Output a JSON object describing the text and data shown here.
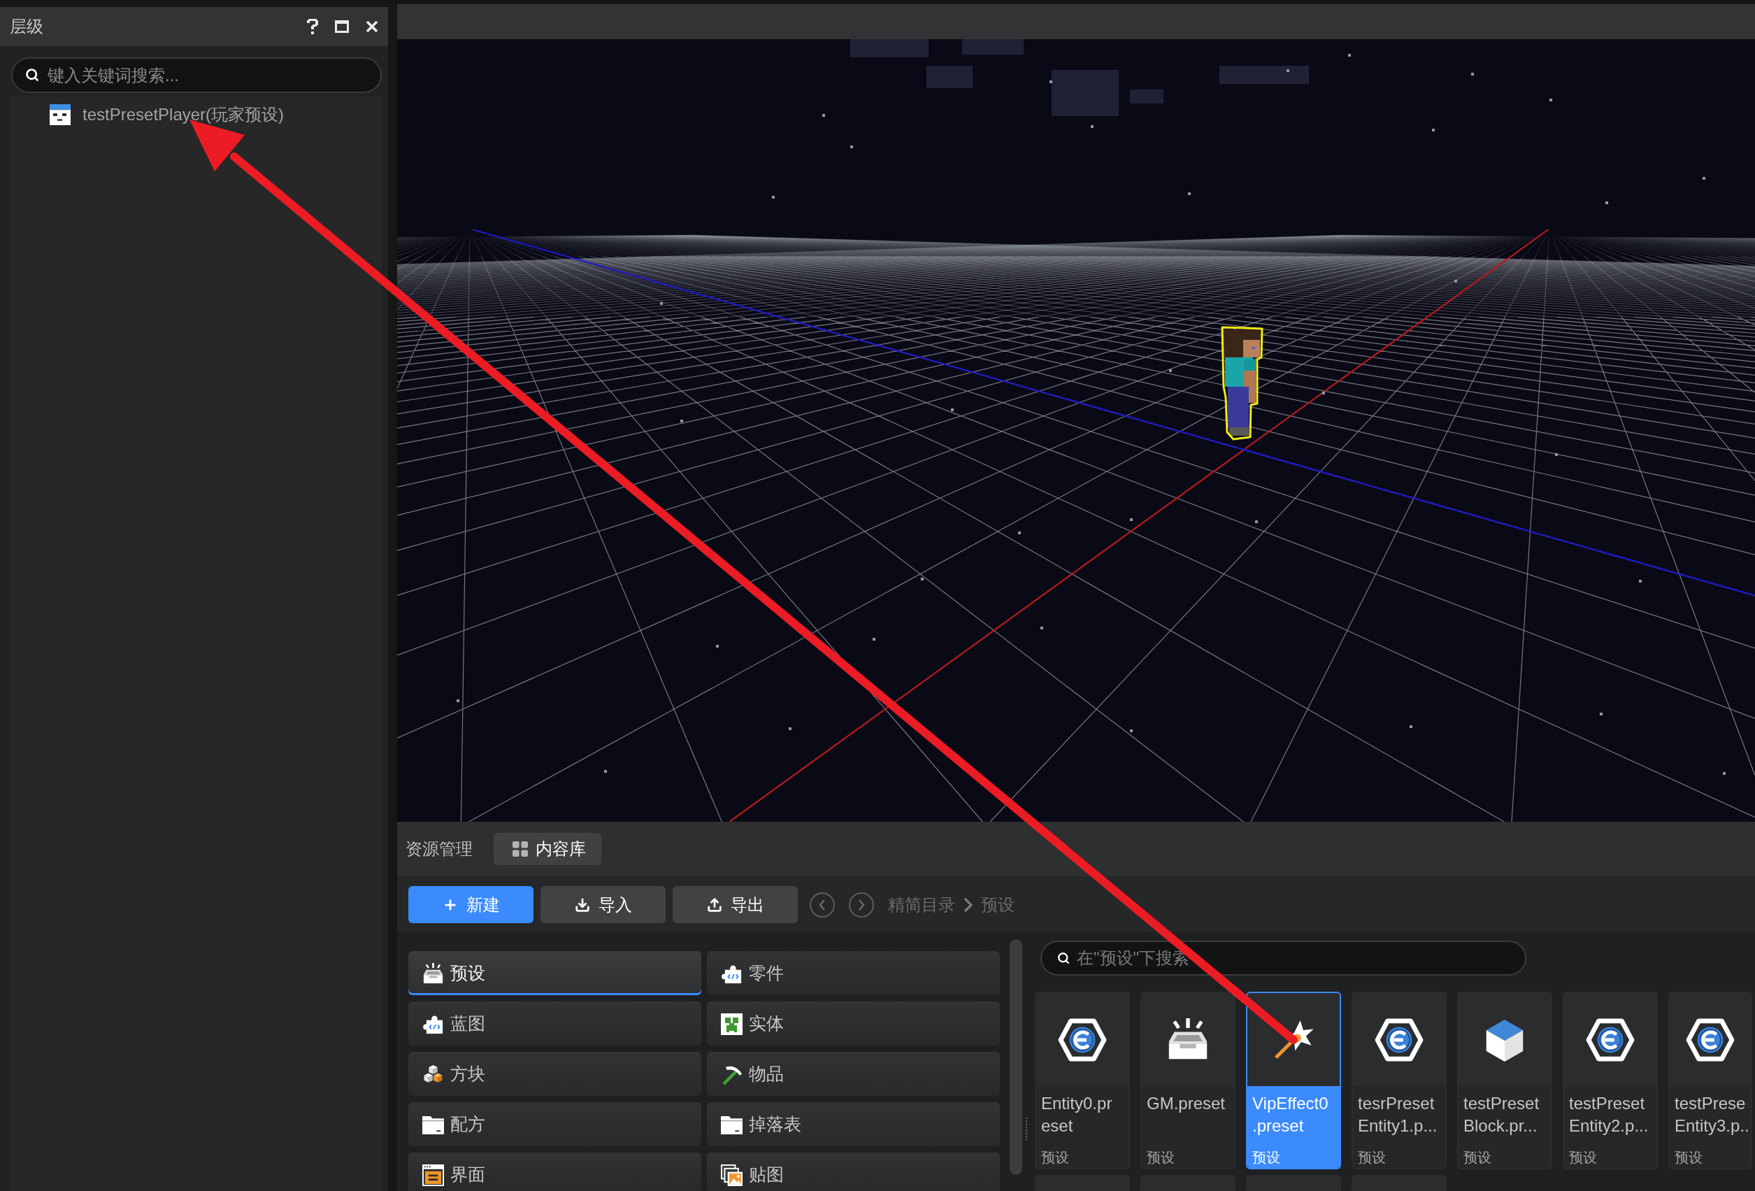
{
  "hierarchy_panel": {
    "title": "层级",
    "search": {
      "placeholder": "键入关键词搜索..."
    },
    "tree": [
      {
        "label": "testPresetPlayer(玩家预设)",
        "kind": "player",
        "selected": false
      }
    ]
  },
  "asset_panel": {
    "title": "资源管理",
    "tabs": [
      {
        "label": "内容库",
        "selected": true
      }
    ],
    "toolbar": [
      {
        "label": "新建",
        "kind": "new"
      },
      {
        "label": "导入",
        "kind": "import"
      },
      {
        "label": "导出",
        "kind": "export"
      }
    ],
    "breadcrumb": [
      "精简目录",
      "预设"
    ],
    "categories": [
      {
        "label": "预设",
        "kind": "preset",
        "selected": true
      },
      {
        "label": "零件",
        "kind": "part",
        "selected": false
      },
      {
        "label": "蓝图",
        "kind": "blueprint",
        "selected": false
      },
      {
        "label": "实体",
        "kind": "entity",
        "selected": false
      },
      {
        "label": "方块",
        "kind": "block",
        "selected": false
      },
      {
        "label": "物品",
        "kind": "item",
        "selected": false
      },
      {
        "label": "配方",
        "kind": "recipe",
        "selected": false
      },
      {
        "label": "掉落表",
        "kind": "loot_table",
        "selected": false
      },
      {
        "label": "界面",
        "kind": "ui",
        "selected": false
      },
      {
        "label": "贴图",
        "kind": "texture",
        "selected": false
      }
    ],
    "search": {
      "placeholder": "在\"预设\"下搜索"
    },
    "assets": [
      {
        "kind": "entity",
        "name_lines": [
          "Entity0.pr",
          "eset"
        ],
        "type": "预设",
        "selected": false
      },
      {
        "kind": "preset",
        "name_lines": [
          "GM.preset"
        ],
        "type": "预设",
        "selected": false
      },
      {
        "kind": "effect",
        "name_lines": [
          "VipEffect0",
          ".preset"
        ],
        "type": "预设",
        "selected": true
      },
      {
        "kind": "entity",
        "name_lines": [
          "tesrPreset",
          "Entity1.p..."
        ],
        "type": "预设",
        "selected": false
      },
      {
        "kind": "block",
        "name_lines": [
          "testPreset",
          "Block.pr..."
        ],
        "type": "预设",
        "selected": false
      },
      {
        "kind": "entity",
        "name_lines": [
          "testPreset",
          "Entity2.p..."
        ],
        "type": "预设",
        "selected": false
      },
      {
        "kind": "entity",
        "name_lines": [
          "testPrese",
          "Entity3.p.."
        ],
        "type": "预设",
        "selected": false
      },
      {
        "kind": "clipped"
      },
      {
        "kind": "clipped"
      },
      {
        "kind": "clipped"
      },
      {
        "kind": "clipped"
      }
    ]
  }
}
